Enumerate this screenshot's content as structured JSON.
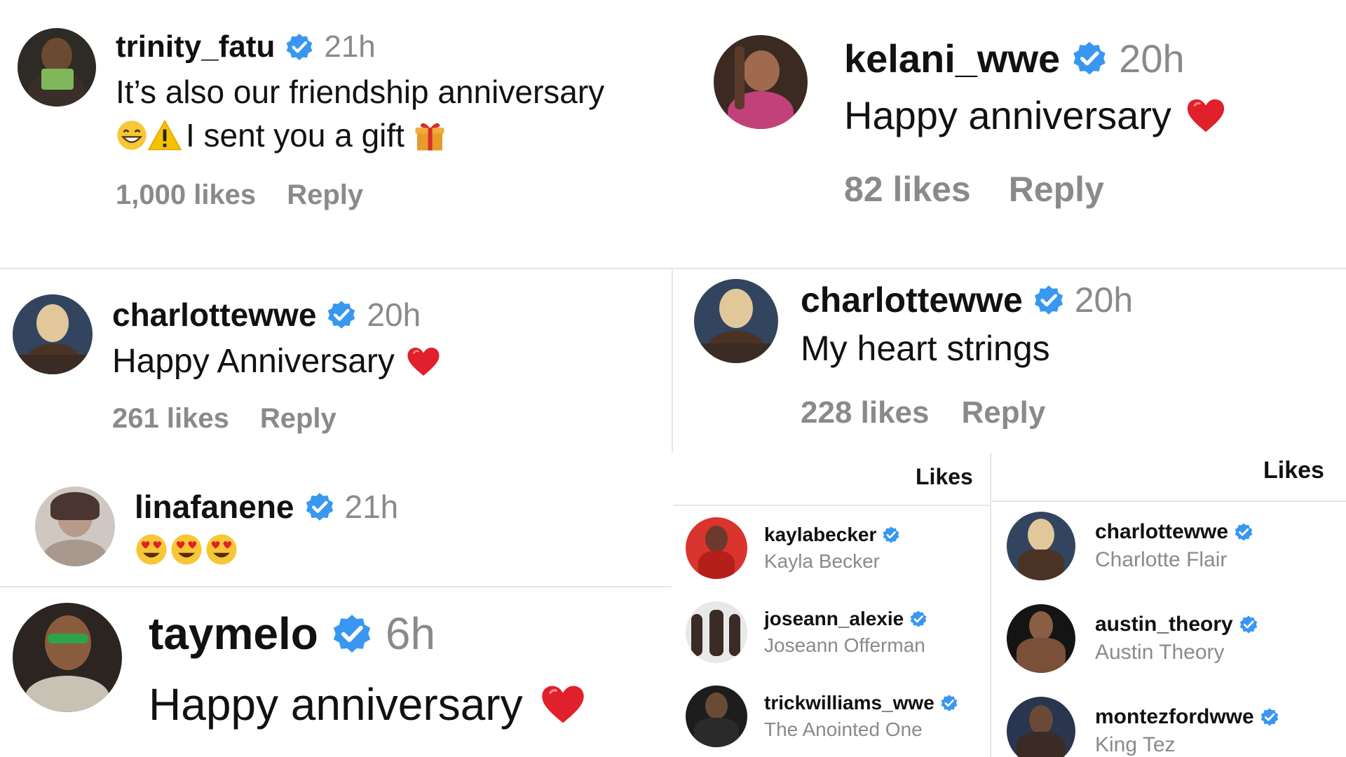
{
  "comments": [
    {
      "username": "trinity_fatu",
      "time": "21h",
      "line1": "It’s also our friendship anniversary",
      "line2": "I sent you a gift",
      "likes": "1,000 likes",
      "reply": "Reply",
      "avatar_colors": [
        "#2e2a26",
        "#6b4a32",
        "#7fb85a"
      ]
    },
    {
      "username": "kelani_wwe",
      "time": "20h",
      "line1": "Happy anniversary",
      "likes": "82 likes",
      "reply": "Reply",
      "avatar_colors": [
        "#3b2a22",
        "#a06a4e",
        "#c2417a"
      ]
    },
    {
      "username": "charlottewwe",
      "time": "20h",
      "line1": "Happy Anniversary",
      "likes": "261 likes",
      "reply": "Reply",
      "avatar_colors": [
        "#33445f",
        "#e1c79a",
        "#4a3325"
      ]
    },
    {
      "username": "charlottewwe",
      "time": "20h",
      "line1": "My heart strings",
      "likes": "228 likes",
      "reply": "Reply",
      "avatar_colors": [
        "#33445f",
        "#e1c79a",
        "#4a3325"
      ]
    },
    {
      "username": "linafanene",
      "time": "21h",
      "line1": "",
      "likes": "",
      "reply": "",
      "avatar_colors": [
        "#cfc7c2",
        "#4a3530",
        "#b89a8a"
      ]
    },
    {
      "username": "taymelo",
      "time": "6h",
      "line1": "Happy anniversary",
      "likes": "",
      "reply": "",
      "avatar_colors": [
        "#2b2420",
        "#8a5c3e",
        "#2fa34a"
      ]
    }
  ],
  "likes_panels": [
    {
      "title": "Likes",
      "rows": [
        {
          "username": "kaylabecker",
          "name": "Kayla Becker",
          "colors": [
            "#d9342e",
            "#6b3a2c"
          ]
        },
        {
          "username": "joseann_alexie",
          "name": "Joseann Offerman",
          "colors": [
            "#e8e8e8",
            "#3a2b26"
          ]
        },
        {
          "username": "trickwilliams_wwe",
          "name": "The Anointed One",
          "colors": [
            "#1d1d1d",
            "#6a4a36"
          ]
        }
      ]
    },
    {
      "title": "Likes",
      "rows": [
        {
          "username": "charlottewwe",
          "name": "Charlotte Flair",
          "colors": [
            "#33445f",
            "#e1c79a"
          ]
        },
        {
          "username": "austin_theory",
          "name": "Austin Theory",
          "colors": [
            "#141414",
            "#8a5e44"
          ]
        },
        {
          "username": "montezfordwwe",
          "name": "King Tez",
          "colors": [
            "#2a3550",
            "#6a4a36"
          ]
        }
      ]
    }
  ],
  "icons": {
    "verified": "verified-badge-icon",
    "heart": "red-heart-icon",
    "gift": "gift-icon",
    "warning": "warning-icon",
    "grin": "grinning-face-icon",
    "heart_eyes": "heart-eyes-face-icon"
  },
  "colors": {
    "verified_blue": "#3897f0",
    "muted_text": "#8a8a8a",
    "heart_red": "#e0202a"
  }
}
